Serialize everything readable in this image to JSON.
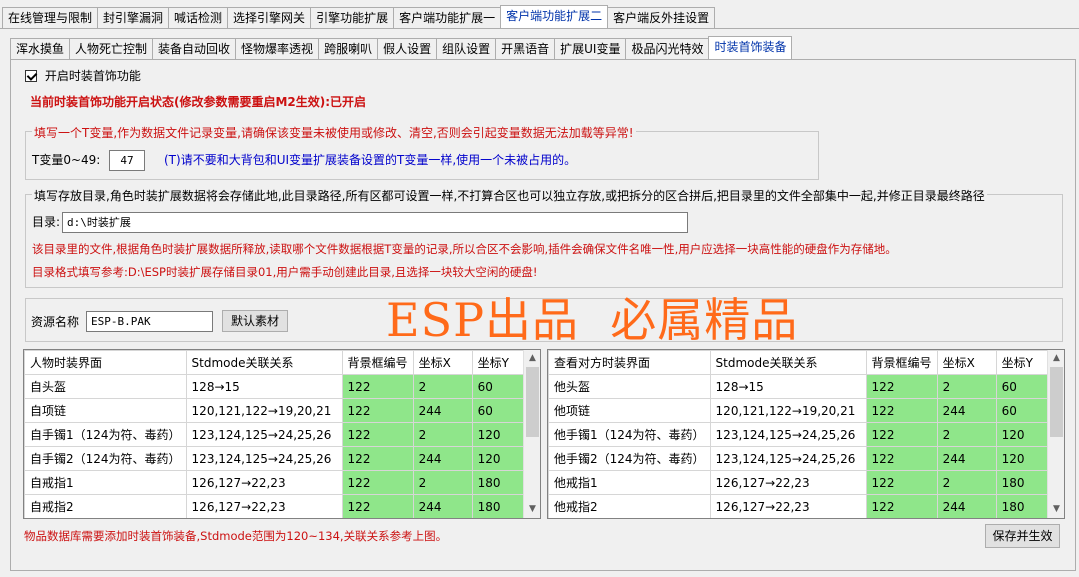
{
  "tabs_main": [
    {
      "label": "在线管理与限制",
      "active": false
    },
    {
      "label": "封引擎漏洞",
      "active": false
    },
    {
      "label": "喊话检测",
      "active": false
    },
    {
      "label": "选择引擎网关",
      "active": false
    },
    {
      "label": "引擎功能扩展",
      "active": false
    },
    {
      "label": "客户端功能扩展一",
      "active": false
    },
    {
      "label": "客户端功能扩展二",
      "active": true
    },
    {
      "label": "客户端反外挂设置",
      "active": false
    }
  ],
  "tabs_sub": [
    {
      "label": "浑水摸鱼",
      "active": false
    },
    {
      "label": "人物死亡控制",
      "active": false
    },
    {
      "label": "装备自动回收",
      "active": false
    },
    {
      "label": "怪物爆率透视",
      "active": false
    },
    {
      "label": "跨服喇叭",
      "active": false
    },
    {
      "label": "假人设置",
      "active": false
    },
    {
      "label": "组队设置",
      "active": false
    },
    {
      "label": "开黑语音",
      "active": false
    },
    {
      "label": "扩展UI变量",
      "active": false
    },
    {
      "label": "极品闪光特效",
      "active": false
    },
    {
      "label": "时装首饰装备",
      "active": true
    }
  ],
  "enable_checkbox": {
    "label": "开启时装首饰功能",
    "checked": true
  },
  "status_line": "当前时装首饰功能开启状态(修改参数需要重启M2生效):已开启",
  "tvar_group": {
    "title": "填写一个T变量,作为数据文件记录变量,请确保该变量未被使用或修改、清空,否则会引起变量数据无法加载等异常!",
    "label": "T变量0~49:",
    "value": "47",
    "hint": "(T)请不要和大背包和UI变量扩展装备设置的T变量一样,使用一个未被占用的。"
  },
  "dir_group": {
    "title": "填写存放目录,角色时装扩展数据将会存储此地,此目录路径,所有区都可设置一样,不打算合区也可以独立存放,或把拆分的区合拼后,把目录里的文件全部集中一起,并修正目录最终路径",
    "label": "目录:",
    "value": "d:\\时装扩展",
    "note1": "该目录里的文件,根据角色时装扩展数据所释放,读取哪个文件数据根据T变量的记录,所以合区不会影响,插件会确保文件名唯一性,用户应选择一块高性能的硬盘作为存储地。",
    "note2": "目录格式填写参考:D:\\ESP时装扩展存储目录01,用户需手动创建此目录,且选择一块较大空闲的硬盘!"
  },
  "resource": {
    "label": "资源名称",
    "value": "ESP-B.PAK",
    "default_button": "默认素材",
    "watermark": "ESP出品  必属精品"
  },
  "grid_left": {
    "headers": [
      "人物时装界面",
      "Stdmode关联关系",
      "背景框编号",
      "坐标X",
      "坐标Y"
    ],
    "rows": [
      [
        "自头盔",
        "128→15",
        "122",
        "2",
        "60"
      ],
      [
        "自项链",
        "120,121,122→19,20,21",
        "122",
        "244",
        "60"
      ],
      [
        "自手镯1（124为符、毒药）",
        "123,124,125→24,25,26",
        "122",
        "2",
        "120"
      ],
      [
        "自手镯2（124为符、毒药）",
        "123,124,125→24,25,26",
        "122",
        "244",
        "120"
      ],
      [
        "自戒指1",
        "126,127→22,23",
        "122",
        "2",
        "180"
      ],
      [
        "自戒指2",
        "126,127→22,23",
        "122",
        "244",
        "180"
      ]
    ]
  },
  "grid_right": {
    "headers": [
      "查看对方时装界面",
      "Stdmode关联关系",
      "背景框编号",
      "坐标X",
      "坐标Y"
    ],
    "rows": [
      [
        "他头盔",
        "128→15",
        "122",
        "2",
        "60"
      ],
      [
        "他项链",
        "120,121,122→19,20,21",
        "122",
        "244",
        "60"
      ],
      [
        "他手镯1（124为符、毒药）",
        "123,124,125→24,25,26",
        "122",
        "2",
        "120"
      ],
      [
        "他手镯2（124为符、毒药）",
        "123,124,125→24,25,26",
        "122",
        "244",
        "120"
      ],
      [
        "他戒指1",
        "126,127→22,23",
        "122",
        "2",
        "180"
      ],
      [
        "他戒指2",
        "126,127→22,23",
        "122",
        "244",
        "180"
      ]
    ]
  },
  "footer_note": "物品数据库需要添加时装首饰装备,Stdmode范围为120~134,关联关系参考上图。",
  "save_button": "保存并生效",
  "colors": {
    "green_cell": "#8fe68a",
    "red_text": "#cc1111",
    "blue_text": "#0000cc",
    "watermark": "#ff6a1a",
    "active_tab_text": "#0033aa"
  }
}
